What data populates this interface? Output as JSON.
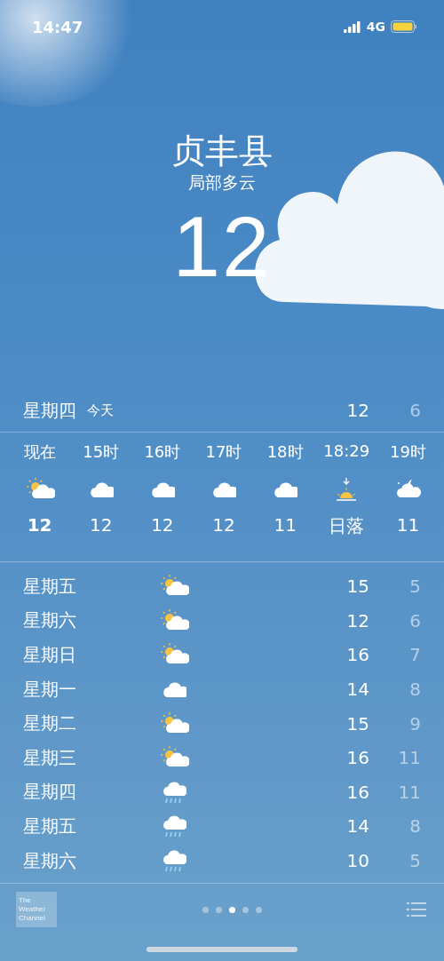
{
  "status_bar": {
    "time": "14:47",
    "network": "4G"
  },
  "header": {
    "city": "贞丰县",
    "condition": "局部多云",
    "temperature": "12"
  },
  "today": {
    "day": "星期四",
    "label": "今天",
    "high": "12",
    "low": "6"
  },
  "hourly": [
    {
      "time": "现在",
      "kind": "partly_cloudy",
      "value": "12"
    },
    {
      "time": "15时",
      "kind": "cloudy",
      "value": "12"
    },
    {
      "time": "16时",
      "kind": "cloudy",
      "value": "12"
    },
    {
      "time": "17时",
      "kind": "cloudy",
      "value": "12"
    },
    {
      "time": "18时",
      "kind": "cloudy",
      "value": "11"
    },
    {
      "time": "18:29",
      "kind": "sunset",
      "value": "日落"
    },
    {
      "time": "19时",
      "kind": "night_cloudy",
      "value": "11"
    }
  ],
  "daily": [
    {
      "day": "星期五",
      "kind": "partly_cloudy",
      "high": "15",
      "low": "5"
    },
    {
      "day": "星期六",
      "kind": "partly_cloudy",
      "high": "12",
      "low": "6"
    },
    {
      "day": "星期日",
      "kind": "partly_cloudy",
      "high": "16",
      "low": "7"
    },
    {
      "day": "星期一",
      "kind": "cloudy",
      "high": "14",
      "low": "8"
    },
    {
      "day": "星期二",
      "kind": "partly_cloudy",
      "high": "15",
      "low": "9"
    },
    {
      "day": "星期三",
      "kind": "partly_cloudy",
      "high": "16",
      "low": "11"
    },
    {
      "day": "星期四",
      "kind": "rain",
      "high": "16",
      "low": "11"
    },
    {
      "day": "星期五",
      "kind": "rain",
      "high": "14",
      "low": "8"
    },
    {
      "day": "星期六",
      "kind": "rain",
      "high": "10",
      "low": "5"
    }
  ],
  "footer": {
    "logo_lines": [
      "The",
      "Weather",
      "Channel"
    ],
    "pages": [
      {
        "selected": false
      },
      {
        "selected": false
      },
      {
        "selected": true
      },
      {
        "selected": false
      },
      {
        "selected": false
      }
    ]
  }
}
